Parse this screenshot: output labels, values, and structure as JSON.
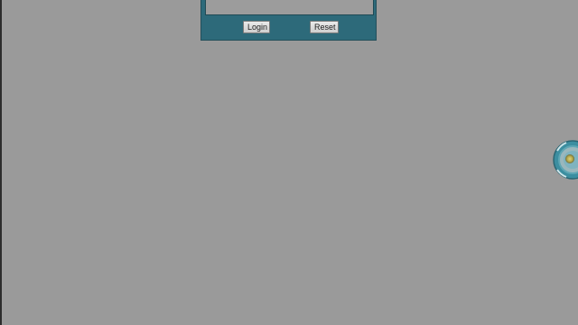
{
  "login_form": {
    "login_label": "Login",
    "reset_label": "Reset"
  },
  "side_widget": {
    "icon": "gauge-dial-icon"
  },
  "colors": {
    "background": "#9a9a9a",
    "panel": "#2d6a7a"
  }
}
